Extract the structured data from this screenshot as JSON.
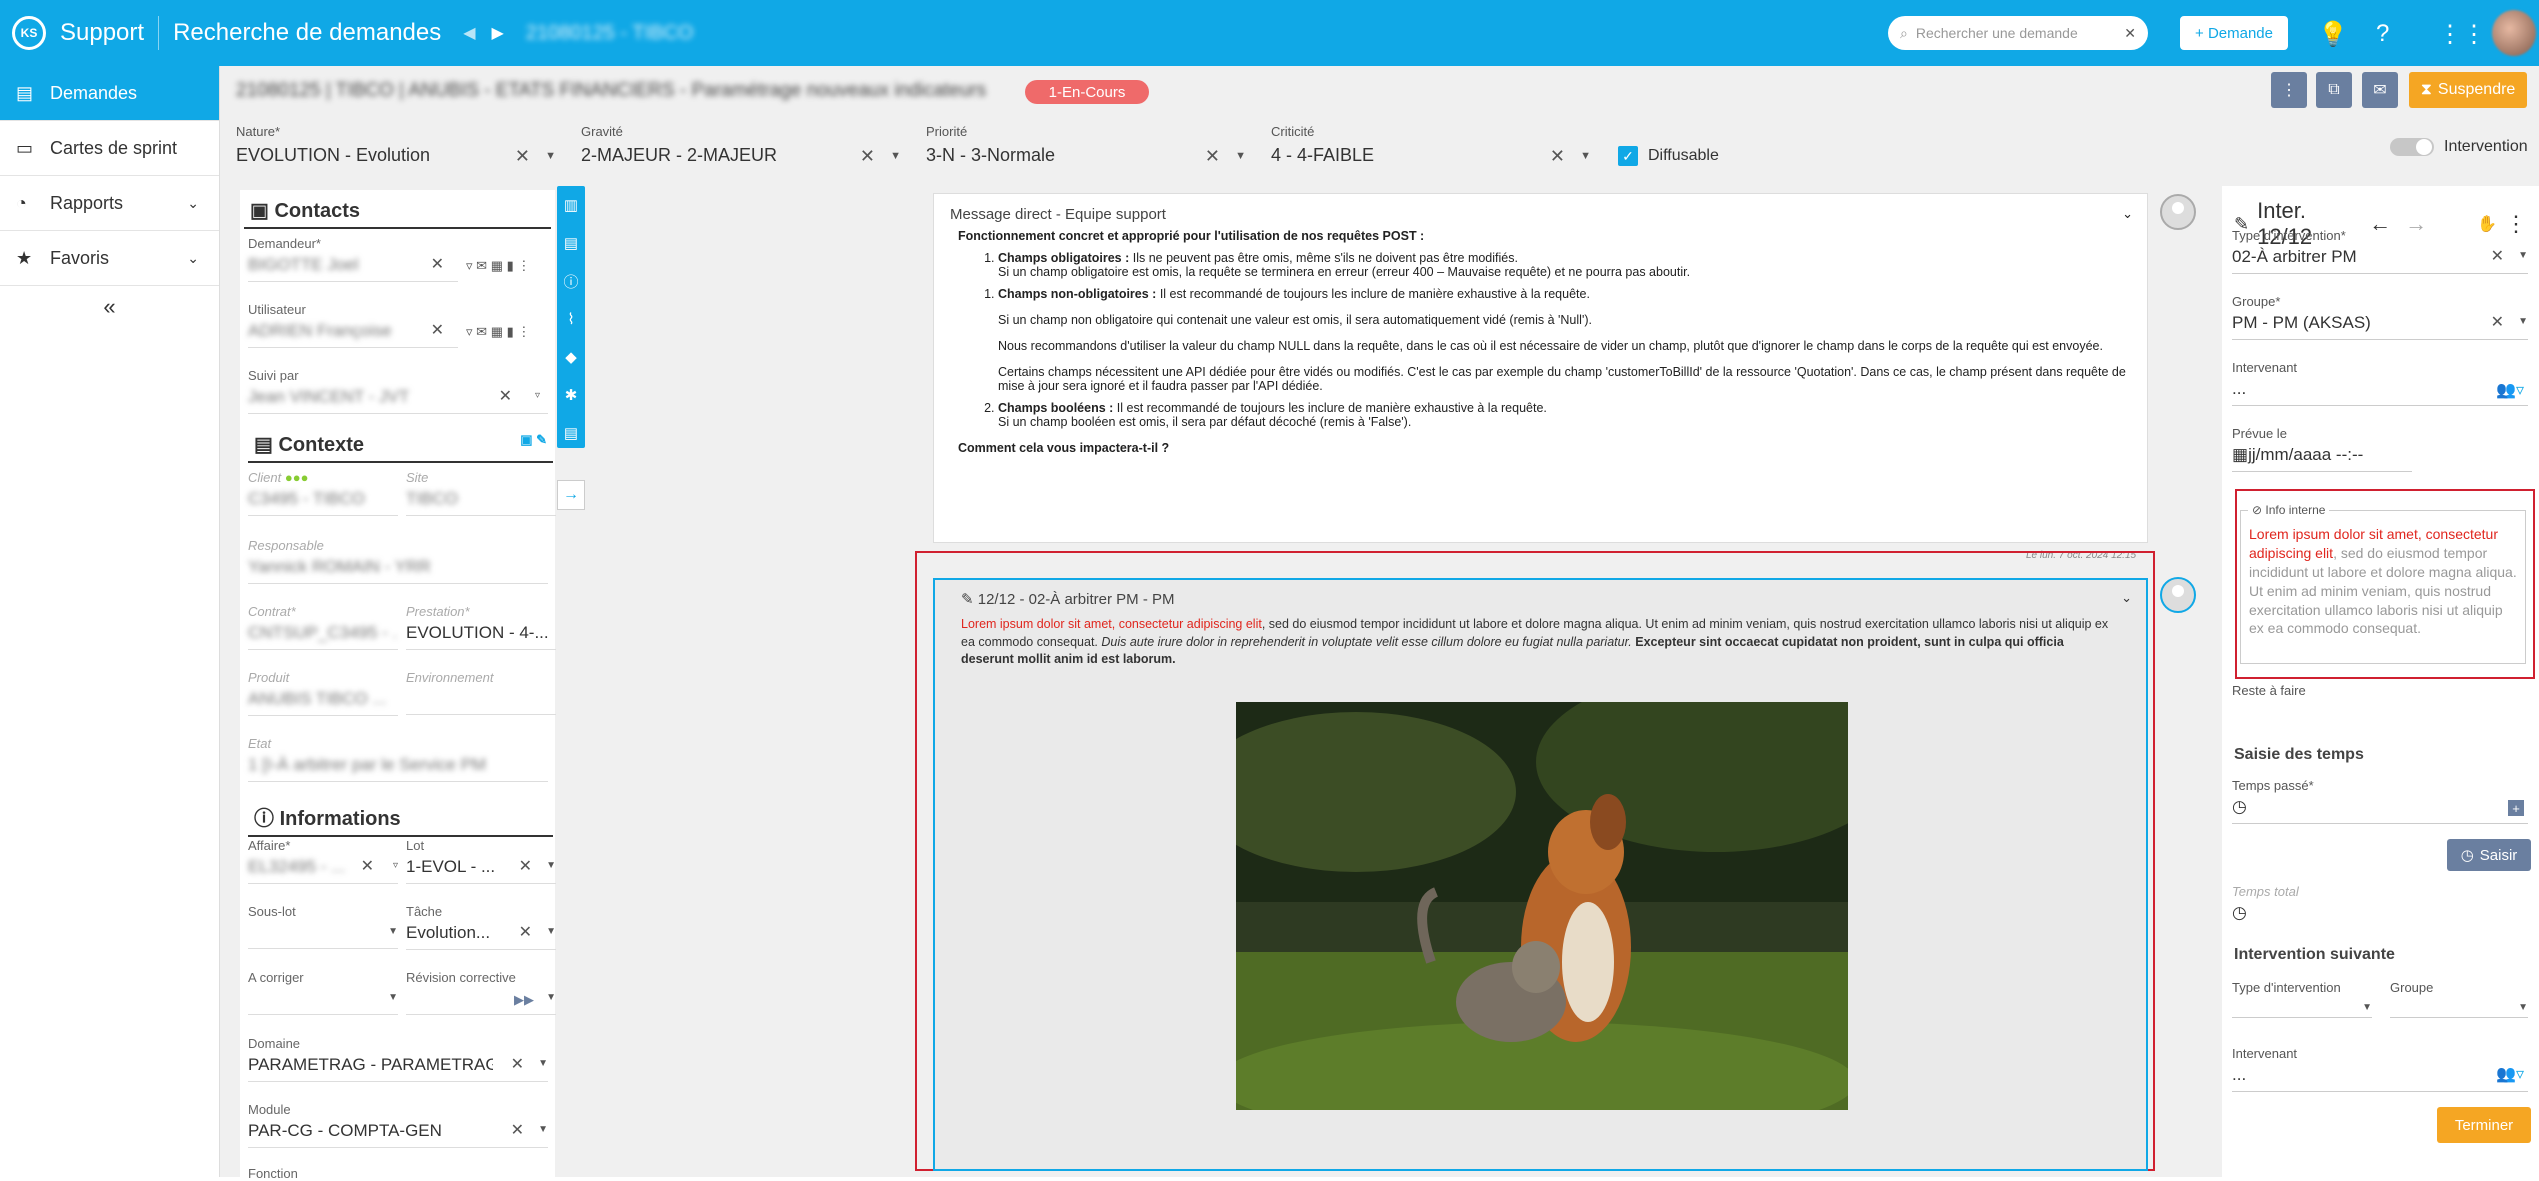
{
  "topbar": {
    "app": "Support",
    "title": "Recherche de demandes",
    "crumb": "21080125 - TIBCO",
    "search_placeholder": "Rechercher une demande",
    "new_button": "+ Demande"
  },
  "sidebar": {
    "items": [
      {
        "label": "Demandes"
      },
      {
        "label": "Cartes de sprint"
      },
      {
        "label": "Rapports"
      },
      {
        "label": "Favoris"
      }
    ],
    "collapse": "«"
  },
  "request": {
    "title": "21080125 | TIBCO | ANUBIS - ETATS FINANCIERS - Paramétrage nouveaux indicateurs",
    "status": "1-En-Cours",
    "suspend": "Suspendre"
  },
  "fields": {
    "nature_label": "Nature*",
    "nature": "EVOLUTION - Evolution",
    "gravite_label": "Gravité",
    "gravite": "2-MAJEUR - 2-MAJEUR",
    "priorite_label": "Priorité",
    "priorite": "3-N - 3-Normale",
    "criticite_label": "Criticité",
    "criticite": "4 - 4-FAIBLE",
    "diffusable": "Diffusable",
    "intervention": "Intervention"
  },
  "contacts": {
    "title": "Contacts",
    "demandeur_label": "Demandeur*",
    "demandeur": "BIGOTTE Joel",
    "utilisateur_label": "Utilisateur",
    "utilisateur": "ADRIEN Françoise",
    "suivi_label": "Suivi par",
    "suivi": "Jean VINCENT - JVT"
  },
  "contexte": {
    "title": "Contexte",
    "client_label": "Client",
    "client": "C3495 - TIBCO",
    "site_label": "Site",
    "site": "TIBCO",
    "resp_label": "Responsable",
    "resp": "Yannick ROMAIN - YRR",
    "contrat_label": "Contrat*",
    "contrat": "CNTSUP_C3495 - ...",
    "prestation_label": "Prestation*",
    "prestation": "EVOLUTION - 4-...",
    "produit_label": "Produit",
    "produit": "ANUBIS TIBCO ...",
    "env_label": "Environnement",
    "etat_label": "Etat",
    "etat": "1 [I-À arbitrer par le Service PM"
  },
  "informations": {
    "title": "Informations",
    "affaire_label": "Affaire*",
    "affaire": "EL32495 - ...",
    "lot_label": "Lot",
    "lot": "1-EVOL - ...",
    "souslot_label": "Sous-lot",
    "tache_label": "Tâche",
    "tache": "Evolution...",
    "corriger_label": "A corriger",
    "revision_label": "Révision corrective",
    "domaine_label": "Domaine",
    "domaine": "PARAMETRAG - PARAMETRAG...",
    "module_label": "Module",
    "module": "PAR-CG - COMPTA-GEN",
    "fonction_label": "Fonction"
  },
  "message1": {
    "header": "Message direct - Equipe support",
    "intro": "Fonctionnement concret et approprié pour l'utilisation de nos requêtes POST :",
    "c1_title": "Champs obligatoires :",
    "c1_text": " Ils ne peuvent pas être omis, même s'ils ne doivent pas être modifiés.",
    "c1_text2": "Si un champ obligatoire est omis, la requête se terminera en erreur (erreur 400 – Mauvaise requête) et ne pourra pas aboutir.",
    "c2_title": "Champs non-obligatoires :",
    "c2_text": " Il est recommandé de toujours les inclure de manière exhaustive à la requête.",
    "p1": "Si un champ non obligatoire qui contenait une valeur est omis, il sera automatiquement vidé (remis à 'Null').",
    "p2": "Nous recommandons d'utiliser la valeur du champ NULL dans la requête, dans le cas où il est nécessaire de vider un champ, plutôt que d'ignorer le champ dans le corps de la requête qui est envoyée.",
    "p3": "Certains champs nécessitent une API dédiée pour être vidés ou modifiés. C'est le cas par exemple du champ 'customerToBillId' de la ressource 'Quotation'. Dans ce cas, le champ présent dans requête de mise à jour sera ignoré et il faudra passer par l'API dédiée.",
    "c3_title": "Champs booléens :",
    "c3_text": " Il est recommandé de toujours les inclure de manière exhaustive à la requête.",
    "c3_text2": "Si un champ booléen est omis, il sera par défaut décoché (remis à 'False').",
    "question": "Comment cela vous impactera-t-il ?",
    "date": "Le lun. 7 oct. 2024 12:15"
  },
  "message2": {
    "header": "12/12 - 02-À arbitrer PM - PM",
    "red": "Lorem ipsum dolor sit amet, consectetur adipiscing elit",
    "text1": ", sed do eiusmod tempor incididunt ut labore et dolore magna aliqua. Ut enim ad minim veniam, quis nostrud exercitation ullamco laboris nisi ut aliquip ex ea commodo consequat. ",
    "italic": "Duis aute irure dolor in reprehenderit in voluptate velit esse cillum dolore eu fugiat nulla pariatur. ",
    "bold": "Excepteur sint occaecat cupidatat non proident, sunt in culpa qui officia deserunt mollit anim id est laborum."
  },
  "intervention": {
    "title": "Inter. 12/12",
    "type_label": "Type d'intervention*",
    "type": "02-À arbitrer PM",
    "groupe_label": "Groupe*",
    "groupe": "PM - PM (AKSAS)",
    "intervenant_label": "Intervenant",
    "intervenant": "...",
    "prevue_label": "Prévue le",
    "prevue": "jj/mm/aaaa --:--",
    "info_label": "Info interne",
    "info_red": "Lorem ipsum dolor sit amet, consectetur adipiscing elit",
    "info_text": ", sed do eiusmod tempor incididunt ut labore et dolore magna aliqua. Ut enim ad minim veniam, quis nostrud exercitation ullamco laboris nisi ut aliquip ex ea commodo consequat.",
    "reste_label": "Reste à faire",
    "saisie_title": "Saisie des temps",
    "temps_label": "Temps passé*",
    "saisir": "Saisir",
    "total_label": "Temps total",
    "suivante_title": "Intervention suivante",
    "type2_label": "Type d'intervention",
    "groupe2_label": "Groupe",
    "intervenant2_label": "Intervenant",
    "intervenant2": "...",
    "terminer": "Terminer"
  },
  "colors": {
    "accent": "#10a8e6",
    "status": "#ef6a6a",
    "warning": "#f5a623",
    "highlight": "#d02030"
  }
}
